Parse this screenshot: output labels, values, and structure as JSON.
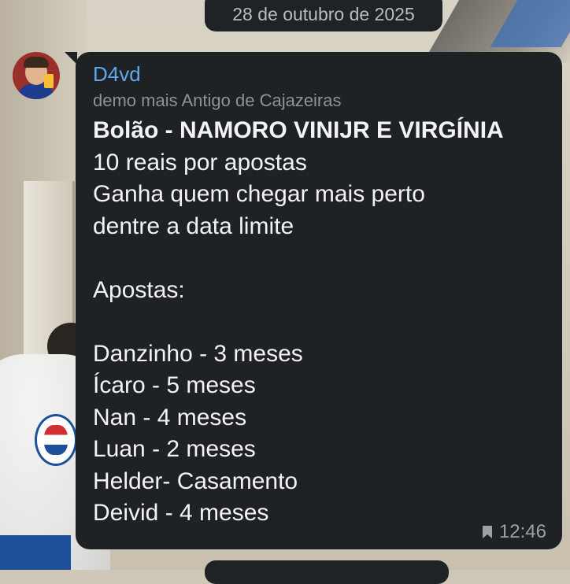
{
  "date_separator": "28 de outubro de 2025",
  "message": {
    "sender": "D4vd",
    "forwarded_from": "demo mais Antigo de Cajazeiras",
    "title": "Bolão - NAMORO VINIJR E VIRGÍNIA",
    "lines": [
      "10 reais por apostas",
      "Ganha quem chegar mais perto",
      "dentre a data limite",
      "",
      "Apostas:",
      "",
      "Danzinho - 3 meses",
      "Ícaro - 5 meses",
      "Nan - 4 meses",
      "Luan - 2 meses",
      "Helder- Casamento",
      "Deivid - 4 meses"
    ],
    "time": "12:46",
    "status_icon": "bookmark-icon"
  },
  "colors": {
    "bubble": "#1f2225",
    "sender": "#5fa8f0",
    "text": "#f2f3f4",
    "meta": "#9aa1a8"
  }
}
